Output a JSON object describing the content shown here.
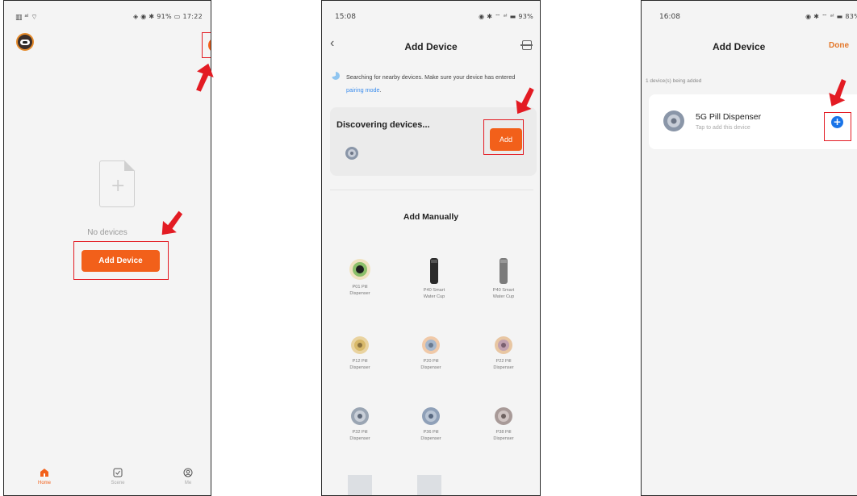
{
  "colors": {
    "accent_orange": "#f2601a",
    "highlight_red": "#e31b23",
    "link_blue": "#3b8ded",
    "add_blue": "#1a74e8",
    "done_orange": "#e4772a"
  },
  "phone1": {
    "status_left": "▥ ᵃˡ ⌔",
    "status_right": "◈ ◉ ✱ 91% ▭ 17:22",
    "avatar_icon": "robot-avatar-icon",
    "add_icon": "plus-circle-icon",
    "empty_icon": "empty-file-icon",
    "empty_text": "No devices",
    "add_button": "Add Device",
    "tabs": [
      {
        "icon": "home-icon",
        "label": "Home"
      },
      {
        "icon": "scene-icon",
        "label": "Scene"
      },
      {
        "icon": "me-icon",
        "label": "Me"
      }
    ]
  },
  "phone2": {
    "status_left": "15:08",
    "status_right": "◉ ✱ ⌔ ᵃˡ ▬ 93%",
    "back_icon": "back-chevron-icon",
    "title": "Add Device",
    "scan_icon": "scan-icon",
    "search_note_pre": "Searching for nearby devices. Make sure your device has entered ",
    "search_note_link": "pairing mode",
    "search_note_post": ".",
    "discovering": "Discovering devices...",
    "add_button": "Add",
    "manual_title": "Add Manually",
    "devices": [
      {
        "line1": "P01 Pill",
        "line2": "Dispenser"
      },
      {
        "line1": "P40 Smart",
        "line2": "Water Cup"
      },
      {
        "line1": "P40 Smart",
        "line2": "Water Cup"
      },
      {
        "line1": "P12 Pill",
        "line2": "Dispenser"
      },
      {
        "line1": "P20 Pill",
        "line2": "Dispenser"
      },
      {
        "line1": "P22 Pill",
        "line2": "Dispenser"
      },
      {
        "line1": "P32 Pill",
        "line2": "Dispenser"
      },
      {
        "line1": "P36 Pill",
        "line2": "Dispenser"
      },
      {
        "line1": "P38 Pill",
        "line2": "Dispenser"
      }
    ]
  },
  "phone3": {
    "status_left": "16:08",
    "status_right": "◉ ✱ ⌔ ᵃˡ ▬ 83%",
    "title": "Add Device",
    "done": "Done",
    "adding_note": "1 device(s) being added",
    "device_name": "5G Pill Dispenser",
    "device_sub": "Tap to add this device",
    "add_icon": "plus-circle-blue-icon"
  }
}
